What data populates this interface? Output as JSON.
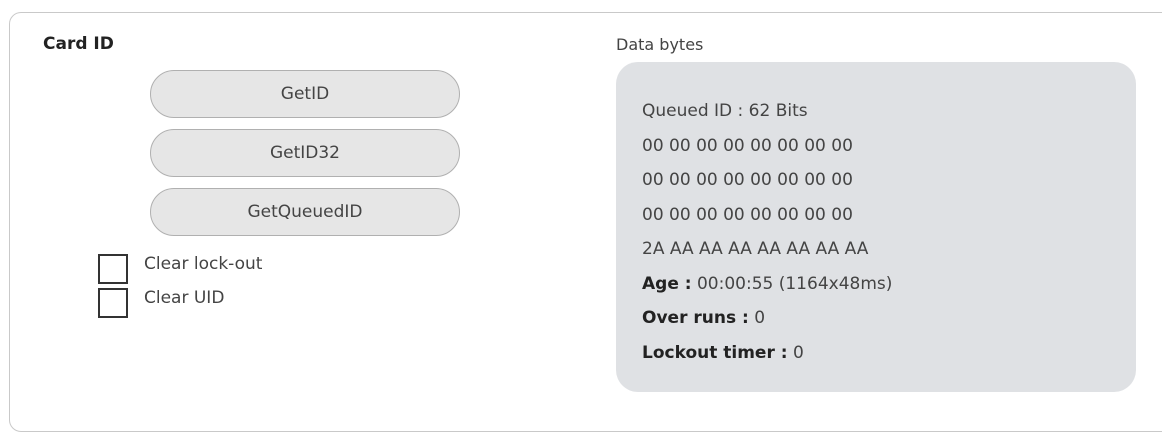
{
  "card": {
    "title": "Card ID",
    "buttons": {
      "get_id": "GetID",
      "get_id32": "GetID32",
      "get_queued_id": "GetQueuedID"
    },
    "checkboxes": {
      "clear_lockout": {
        "label": "Clear lock-out",
        "checked": false
      },
      "clear_uid": {
        "label": "Clear UID",
        "checked": false
      }
    }
  },
  "data": {
    "title": "Data bytes",
    "queued_id": "Queued ID : 62 Bits",
    "bytes": [
      "00 00 00 00 00 00 00 00",
      "00 00 00 00 00 00 00 00",
      "00 00 00 00 00 00 00 00",
      "2A AA AA AA AA AA AA AA"
    ],
    "age_label": "Age :",
    "age_value": "00:00:55 (1164x48ms)",
    "over_runs_label": "Over runs :",
    "over_runs_value": "0",
    "lockout_label": "Lockout timer :",
    "lockout_value": "0"
  }
}
